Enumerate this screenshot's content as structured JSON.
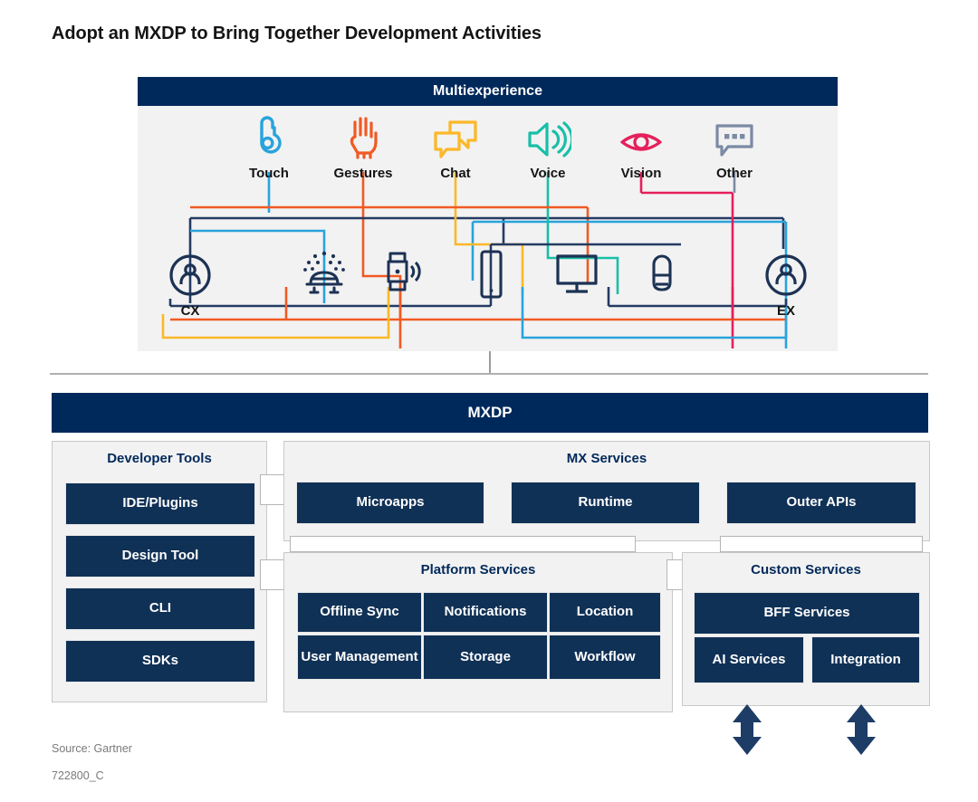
{
  "title": "Adopt an MXDP to Bring Together Development Activities",
  "multiexperience": {
    "header": "Multiexperience",
    "channels": [
      {
        "label": "Touch",
        "icon": "touch-pointer-icon",
        "color": "#29a3dc"
      },
      {
        "label": "Gestures",
        "icon": "open-hand-icon",
        "color": "#f15a24"
      },
      {
        "label": "Chat",
        "icon": "speech-bubbles-icon",
        "color": "#fbb829"
      },
      {
        "label": "Voice",
        "icon": "speaker-icon",
        "color": "#18bfa8"
      },
      {
        "label": "Vision",
        "icon": "eye-icon",
        "color": "#e5205c"
      },
      {
        "label": "Other",
        "icon": "chat-dots-icon",
        "color": "#7b8aa5"
      }
    ],
    "devices": [
      {
        "label": "CX",
        "icon": "person-circle-icon"
      },
      {
        "label": "",
        "icon": "autonomous-vehicle-icon"
      },
      {
        "label": "",
        "icon": "smartwatch-icon"
      },
      {
        "label": "",
        "icon": "smartphone-icon"
      },
      {
        "label": "",
        "icon": "desktop-monitor-icon"
      },
      {
        "label": "",
        "icon": "smart-speaker-icon"
      },
      {
        "label": "EX",
        "icon": "person-circle-icon"
      }
    ]
  },
  "mxdp": {
    "bar_label": "MXDP",
    "developer_tools": {
      "title": "Developer Tools",
      "items": [
        "IDE/Plugins",
        "Design Tool",
        "CLI",
        "SDKs"
      ]
    },
    "mx_services": {
      "title": "MX Services",
      "items": [
        "Microapps",
        "Runtime",
        "Outer APIs"
      ]
    },
    "platform_services": {
      "title": "Platform Services",
      "items": [
        "Offline Sync",
        "Notifications",
        "Location",
        "User Management",
        "Storage",
        "Workflow"
      ]
    },
    "custom_services": {
      "title": "Custom Services",
      "items": [
        "BFF Services",
        "AI Services",
        "Integration"
      ]
    }
  },
  "footer": {
    "source": "Source: Gartner",
    "code": "722800_C"
  },
  "colors": {
    "navy": "#00295b",
    "tile": "#103156",
    "panel_bg": "#f2f2f2"
  }
}
